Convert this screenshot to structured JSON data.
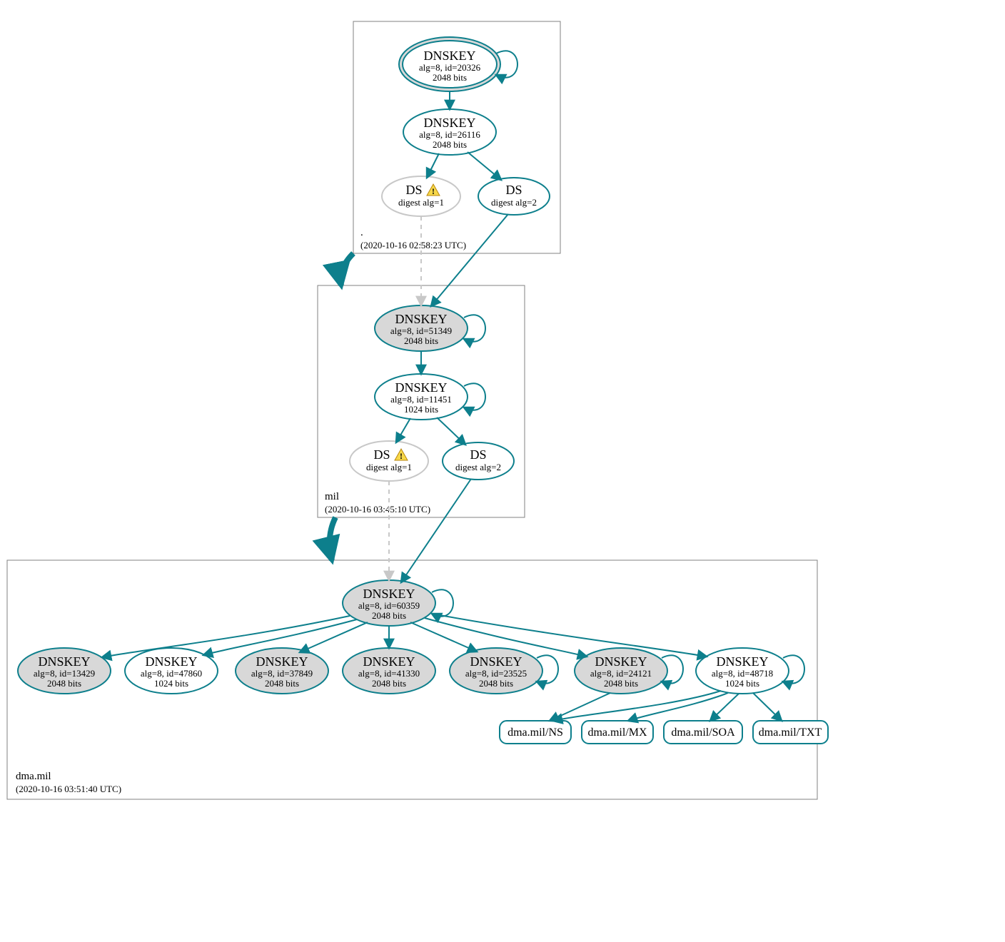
{
  "colors": {
    "teal": "#0d7f8c",
    "gray": "#c8c8c8",
    "box": "#808080"
  },
  "zones": {
    "root": {
      "name": ".",
      "timestamp": "(2020-10-16 02:58:23 UTC)"
    },
    "mil": {
      "name": "mil",
      "timestamp": "(2020-10-16 03:45:10 UTC)"
    },
    "dma": {
      "name": "dma.mil",
      "timestamp": "(2020-10-16 03:51:40 UTC)"
    }
  },
  "nodes": {
    "root_ksk": {
      "title": "DNSKEY",
      "l2": "alg=8, id=20326",
      "l3": "2048 bits"
    },
    "root_zsk": {
      "title": "DNSKEY",
      "l2": "alg=8, id=26116",
      "l3": "2048 bits"
    },
    "root_ds1": {
      "title": "DS",
      "l2": "digest alg=1"
    },
    "root_ds2": {
      "title": "DS",
      "l2": "digest alg=2"
    },
    "mil_ksk": {
      "title": "DNSKEY",
      "l2": "alg=8, id=51349",
      "l3": "2048 bits"
    },
    "mil_zsk": {
      "title": "DNSKEY",
      "l2": "alg=8, id=11451",
      "l3": "1024 bits"
    },
    "mil_ds1": {
      "title": "DS",
      "l2": "digest alg=1"
    },
    "mil_ds2": {
      "title": "DS",
      "l2": "digest alg=2"
    },
    "dma_ksk": {
      "title": "DNSKEY",
      "l2": "alg=8, id=60359",
      "l3": "2048 bits"
    },
    "dma_k1": {
      "title": "DNSKEY",
      "l2": "alg=8, id=13429",
      "l3": "2048 bits"
    },
    "dma_k2": {
      "title": "DNSKEY",
      "l2": "alg=8, id=47860",
      "l3": "1024 bits"
    },
    "dma_k3": {
      "title": "DNSKEY",
      "l2": "alg=8, id=37849",
      "l3": "2048 bits"
    },
    "dma_k4": {
      "title": "DNSKEY",
      "l2": "alg=8, id=41330",
      "l3": "2048 bits"
    },
    "dma_k5": {
      "title": "DNSKEY",
      "l2": "alg=8, id=23525",
      "l3": "2048 bits"
    },
    "dma_k6": {
      "title": "DNSKEY",
      "l2": "alg=8, id=24121",
      "l3": "2048 bits"
    },
    "dma_k7": {
      "title": "DNSKEY",
      "l2": "alg=8, id=48718",
      "l3": "1024 bits"
    }
  },
  "rr": {
    "ns": "dma.mil/NS",
    "mx": "dma.mil/MX",
    "soa": "dma.mil/SOA",
    "txt": "dma.mil/TXT"
  }
}
